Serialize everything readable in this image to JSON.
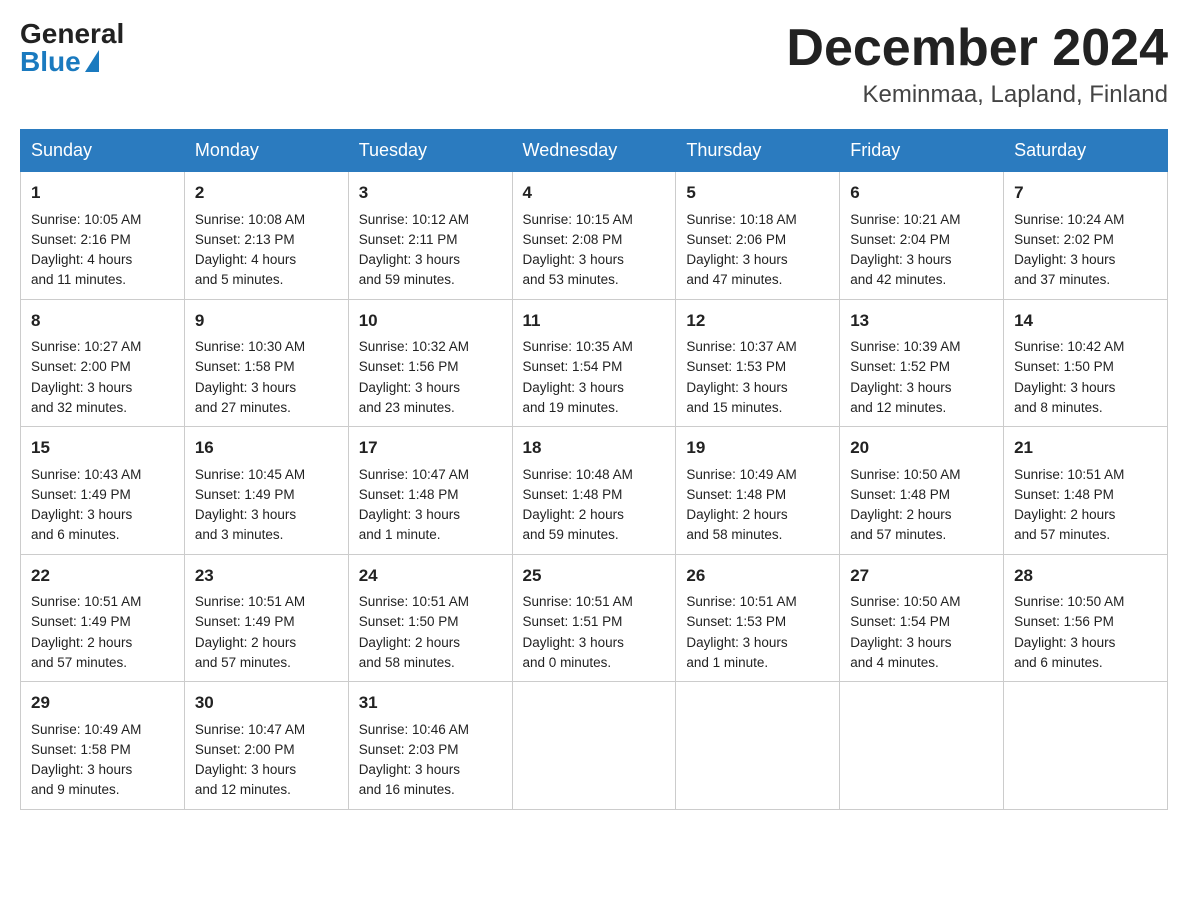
{
  "logo": {
    "general": "General",
    "blue": "Blue"
  },
  "title": "December 2024",
  "location": "Keminmaa, Lapland, Finland",
  "days_header": [
    "Sunday",
    "Monday",
    "Tuesday",
    "Wednesday",
    "Thursday",
    "Friday",
    "Saturday"
  ],
  "weeks": [
    [
      {
        "num": "1",
        "lines": [
          "Sunrise: 10:05 AM",
          "Sunset: 2:16 PM",
          "Daylight: 4 hours",
          "and 11 minutes."
        ]
      },
      {
        "num": "2",
        "lines": [
          "Sunrise: 10:08 AM",
          "Sunset: 2:13 PM",
          "Daylight: 4 hours",
          "and 5 minutes."
        ]
      },
      {
        "num": "3",
        "lines": [
          "Sunrise: 10:12 AM",
          "Sunset: 2:11 PM",
          "Daylight: 3 hours",
          "and 59 minutes."
        ]
      },
      {
        "num": "4",
        "lines": [
          "Sunrise: 10:15 AM",
          "Sunset: 2:08 PM",
          "Daylight: 3 hours",
          "and 53 minutes."
        ]
      },
      {
        "num": "5",
        "lines": [
          "Sunrise: 10:18 AM",
          "Sunset: 2:06 PM",
          "Daylight: 3 hours",
          "and 47 minutes."
        ]
      },
      {
        "num": "6",
        "lines": [
          "Sunrise: 10:21 AM",
          "Sunset: 2:04 PM",
          "Daylight: 3 hours",
          "and 42 minutes."
        ]
      },
      {
        "num": "7",
        "lines": [
          "Sunrise: 10:24 AM",
          "Sunset: 2:02 PM",
          "Daylight: 3 hours",
          "and 37 minutes."
        ]
      }
    ],
    [
      {
        "num": "8",
        "lines": [
          "Sunrise: 10:27 AM",
          "Sunset: 2:00 PM",
          "Daylight: 3 hours",
          "and 32 minutes."
        ]
      },
      {
        "num": "9",
        "lines": [
          "Sunrise: 10:30 AM",
          "Sunset: 1:58 PM",
          "Daylight: 3 hours",
          "and 27 minutes."
        ]
      },
      {
        "num": "10",
        "lines": [
          "Sunrise: 10:32 AM",
          "Sunset: 1:56 PM",
          "Daylight: 3 hours",
          "and 23 minutes."
        ]
      },
      {
        "num": "11",
        "lines": [
          "Sunrise: 10:35 AM",
          "Sunset: 1:54 PM",
          "Daylight: 3 hours",
          "and 19 minutes."
        ]
      },
      {
        "num": "12",
        "lines": [
          "Sunrise: 10:37 AM",
          "Sunset: 1:53 PM",
          "Daylight: 3 hours",
          "and 15 minutes."
        ]
      },
      {
        "num": "13",
        "lines": [
          "Sunrise: 10:39 AM",
          "Sunset: 1:52 PM",
          "Daylight: 3 hours",
          "and 12 minutes."
        ]
      },
      {
        "num": "14",
        "lines": [
          "Sunrise: 10:42 AM",
          "Sunset: 1:50 PM",
          "Daylight: 3 hours",
          "and 8 minutes."
        ]
      }
    ],
    [
      {
        "num": "15",
        "lines": [
          "Sunrise: 10:43 AM",
          "Sunset: 1:49 PM",
          "Daylight: 3 hours",
          "and 6 minutes."
        ]
      },
      {
        "num": "16",
        "lines": [
          "Sunrise: 10:45 AM",
          "Sunset: 1:49 PM",
          "Daylight: 3 hours",
          "and 3 minutes."
        ]
      },
      {
        "num": "17",
        "lines": [
          "Sunrise: 10:47 AM",
          "Sunset: 1:48 PM",
          "Daylight: 3 hours",
          "and 1 minute."
        ]
      },
      {
        "num": "18",
        "lines": [
          "Sunrise: 10:48 AM",
          "Sunset: 1:48 PM",
          "Daylight: 2 hours",
          "and 59 minutes."
        ]
      },
      {
        "num": "19",
        "lines": [
          "Sunrise: 10:49 AM",
          "Sunset: 1:48 PM",
          "Daylight: 2 hours",
          "and 58 minutes."
        ]
      },
      {
        "num": "20",
        "lines": [
          "Sunrise: 10:50 AM",
          "Sunset: 1:48 PM",
          "Daylight: 2 hours",
          "and 57 minutes."
        ]
      },
      {
        "num": "21",
        "lines": [
          "Sunrise: 10:51 AM",
          "Sunset: 1:48 PM",
          "Daylight: 2 hours",
          "and 57 minutes."
        ]
      }
    ],
    [
      {
        "num": "22",
        "lines": [
          "Sunrise: 10:51 AM",
          "Sunset: 1:49 PM",
          "Daylight: 2 hours",
          "and 57 minutes."
        ]
      },
      {
        "num": "23",
        "lines": [
          "Sunrise: 10:51 AM",
          "Sunset: 1:49 PM",
          "Daylight: 2 hours",
          "and 57 minutes."
        ]
      },
      {
        "num": "24",
        "lines": [
          "Sunrise: 10:51 AM",
          "Sunset: 1:50 PM",
          "Daylight: 2 hours",
          "and 58 minutes."
        ]
      },
      {
        "num": "25",
        "lines": [
          "Sunrise: 10:51 AM",
          "Sunset: 1:51 PM",
          "Daylight: 3 hours",
          "and 0 minutes."
        ]
      },
      {
        "num": "26",
        "lines": [
          "Sunrise: 10:51 AM",
          "Sunset: 1:53 PM",
          "Daylight: 3 hours",
          "and 1 minute."
        ]
      },
      {
        "num": "27",
        "lines": [
          "Sunrise: 10:50 AM",
          "Sunset: 1:54 PM",
          "Daylight: 3 hours",
          "and 4 minutes."
        ]
      },
      {
        "num": "28",
        "lines": [
          "Sunrise: 10:50 AM",
          "Sunset: 1:56 PM",
          "Daylight: 3 hours",
          "and 6 minutes."
        ]
      }
    ],
    [
      {
        "num": "29",
        "lines": [
          "Sunrise: 10:49 AM",
          "Sunset: 1:58 PM",
          "Daylight: 3 hours",
          "and 9 minutes."
        ]
      },
      {
        "num": "30",
        "lines": [
          "Sunrise: 10:47 AM",
          "Sunset: 2:00 PM",
          "Daylight: 3 hours",
          "and 12 minutes."
        ]
      },
      {
        "num": "31",
        "lines": [
          "Sunrise: 10:46 AM",
          "Sunset: 2:03 PM",
          "Daylight: 3 hours",
          "and 16 minutes."
        ]
      },
      null,
      null,
      null,
      null
    ]
  ]
}
